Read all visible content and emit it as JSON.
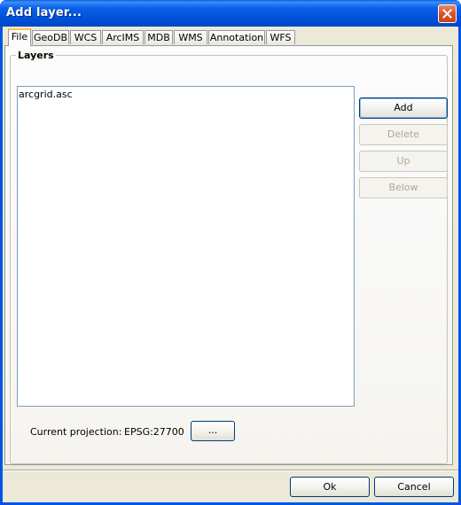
{
  "window": {
    "title": "Add layer..."
  },
  "tabs": [
    {
      "label": "File",
      "active": true
    },
    {
      "label": "GeoDB"
    },
    {
      "label": "WCS"
    },
    {
      "label": "ArcIMS"
    },
    {
      "label": "MDB"
    },
    {
      "label": "WMS"
    },
    {
      "label": "Annotation"
    },
    {
      "label": "WFS"
    }
  ],
  "layers": {
    "group_label": "Layers",
    "items": [
      "arcgrid.asc"
    ],
    "buttons": {
      "add": "Add",
      "delete": "Delete",
      "up": "Up",
      "below": "Below"
    }
  },
  "projection": {
    "label": "Current projection:",
    "value": "EPSG:27700",
    "browse_label": "..."
  },
  "footer": {
    "ok": "Ok",
    "cancel": "Cancel"
  },
  "colors": {
    "titlebar": "#0055e5",
    "dialog_bg": "#ece9d8",
    "active_tab_highlight": "#ffc83c"
  },
  "icons": {
    "close": "close-icon"
  }
}
